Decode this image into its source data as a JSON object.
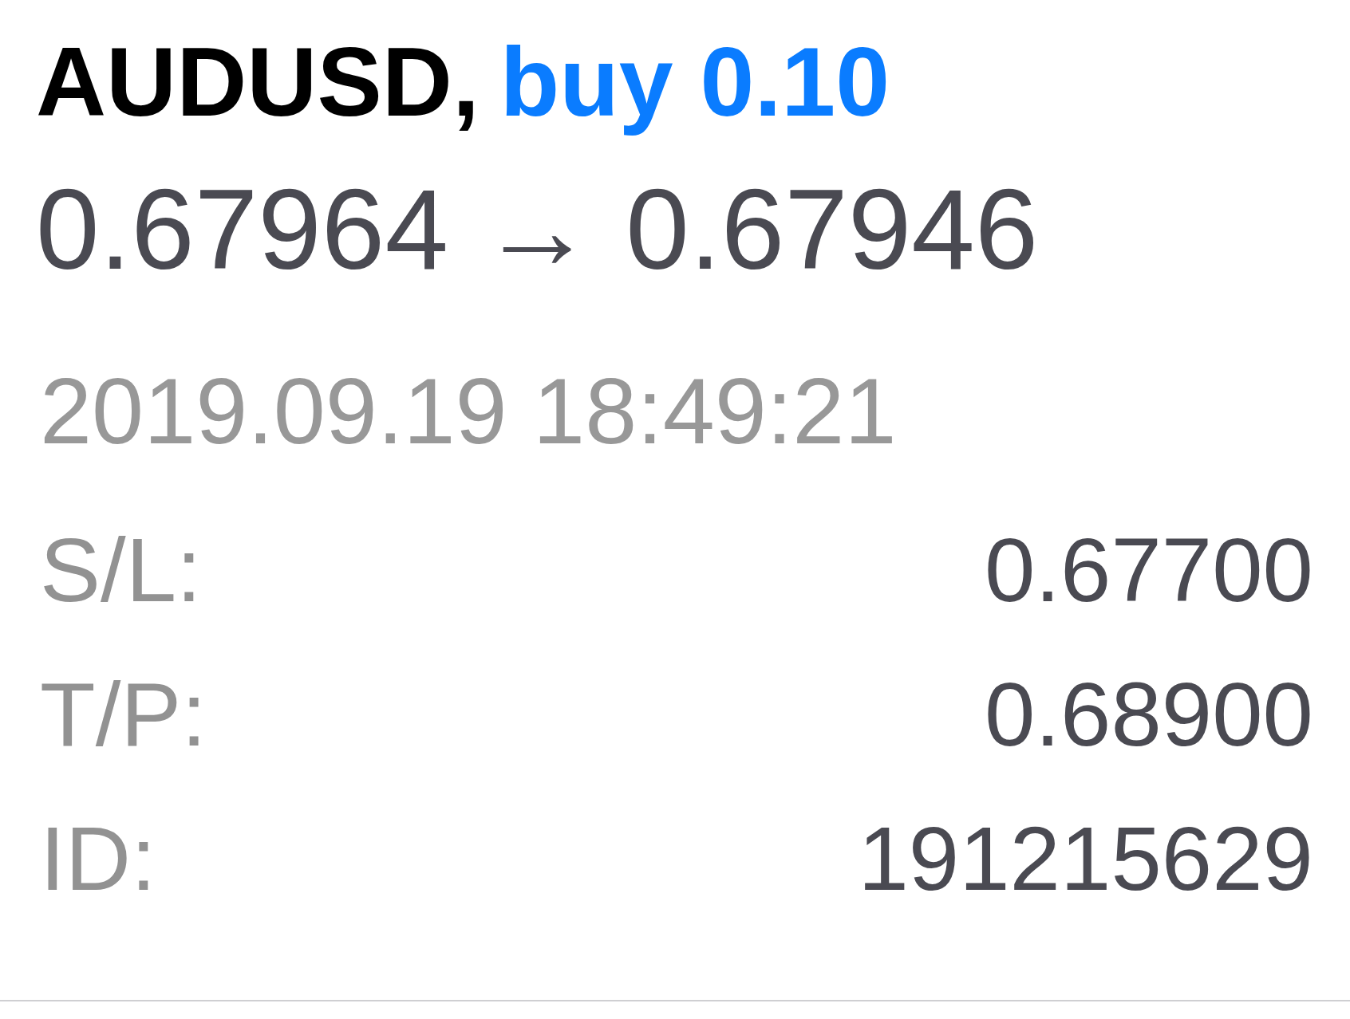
{
  "position": {
    "symbol": "AUDUSD,",
    "order": "buy 0.10",
    "prices": "0.67964 → 0.67946",
    "time": "2019.09.19 18:49:21"
  },
  "details": [
    {
      "label": "S/L:",
      "value": "0.67700"
    },
    {
      "label": "T/P:",
      "value": "0.68900"
    },
    {
      "label": "ID:",
      "value": "191215629"
    }
  ]
}
